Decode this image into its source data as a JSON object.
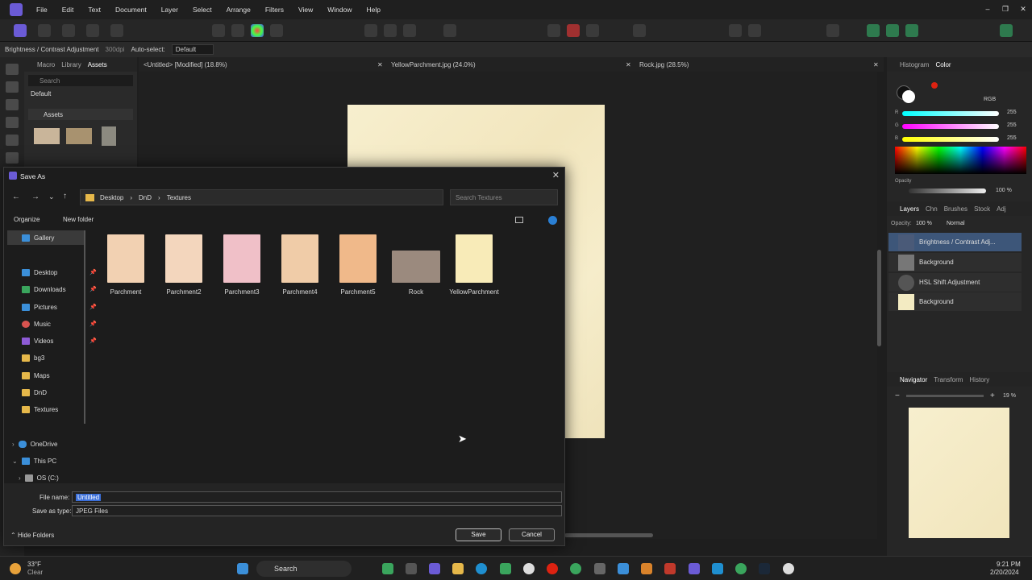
{
  "app": {
    "menu": [
      "File",
      "Edit",
      "Text",
      "Document",
      "Layer",
      "Select",
      "Arrange",
      "Filters",
      "View",
      "Window",
      "Help"
    ],
    "context_bar": {
      "tool_name": "Brightness / Contrast Adjustment",
      "dpi": "300dpi",
      "autoselect_label": "Auto-select:",
      "autoselect_value": "Default"
    },
    "left_panel": {
      "tabs": [
        "Macro",
        "Library",
        "Assets"
      ],
      "search_placeholder": "Search",
      "category": "Default",
      "section": "Assets"
    },
    "doc_tabs": [
      "<Untitled> [Modified] (18.8%)",
      "YellowParchment.jpg (24.0%)",
      "Rock.jpg (28.5%)"
    ],
    "right_panel": {
      "top_tabs": [
        "Histogram",
        "Color"
      ],
      "color_model": "RGB",
      "rgb": {
        "r_label": "R",
        "r": "255",
        "g_label": "G",
        "g": "255",
        "b_label": "B",
        "b": "255"
      },
      "opacity_label": "Opacity",
      "opacity": "100 %",
      "layer_tabs": [
        "Layers",
        "Chn",
        "Brushes",
        "Stock",
        "Adj"
      ],
      "layer_opacity_label": "Opacity:",
      "layer_opacity": "100 %",
      "blend": "Normal",
      "layers": [
        "Brightness / Contrast Adj...",
        "Background",
        "HSL Shift Adjustment",
        "Background"
      ],
      "nav_tabs": [
        "Navigator",
        "Transform",
        "History"
      ],
      "zoom": "19 %"
    },
    "colors": {
      "accent": "#3d5679",
      "parchment": "#f6edcb"
    }
  },
  "dialog": {
    "title": "Save As",
    "breadcrumb": [
      "Desktop",
      "DnD",
      "Textures"
    ],
    "search_placeholder": "Search Textures",
    "organize": "Organize",
    "new_folder": "New folder",
    "nav": {
      "gallery": "Gallery",
      "quick": [
        "Desktop",
        "Downloads",
        "Pictures",
        "Music",
        "Videos",
        "bg3",
        "Maps",
        "DnD",
        "Textures"
      ],
      "onedrive": "OneDrive",
      "this_pc": "This PC",
      "drive": "OS (C:)"
    },
    "files": [
      "Parchment",
      "Parchment2",
      "Parchment3",
      "Parchment4",
      "Parchment5",
      "Rock",
      "YellowParchment"
    ],
    "filename_label": "File name:",
    "filename": "Untitled",
    "type_label": "Save as type:",
    "type": "JPEG Files",
    "hide_folders": "Hide Folders",
    "save": "Save",
    "cancel": "Cancel"
  },
  "taskbar": {
    "temp": "33°F",
    "weather": "Clear",
    "search": "Search",
    "time": "9:21 PM",
    "date": "2/20/2024"
  }
}
